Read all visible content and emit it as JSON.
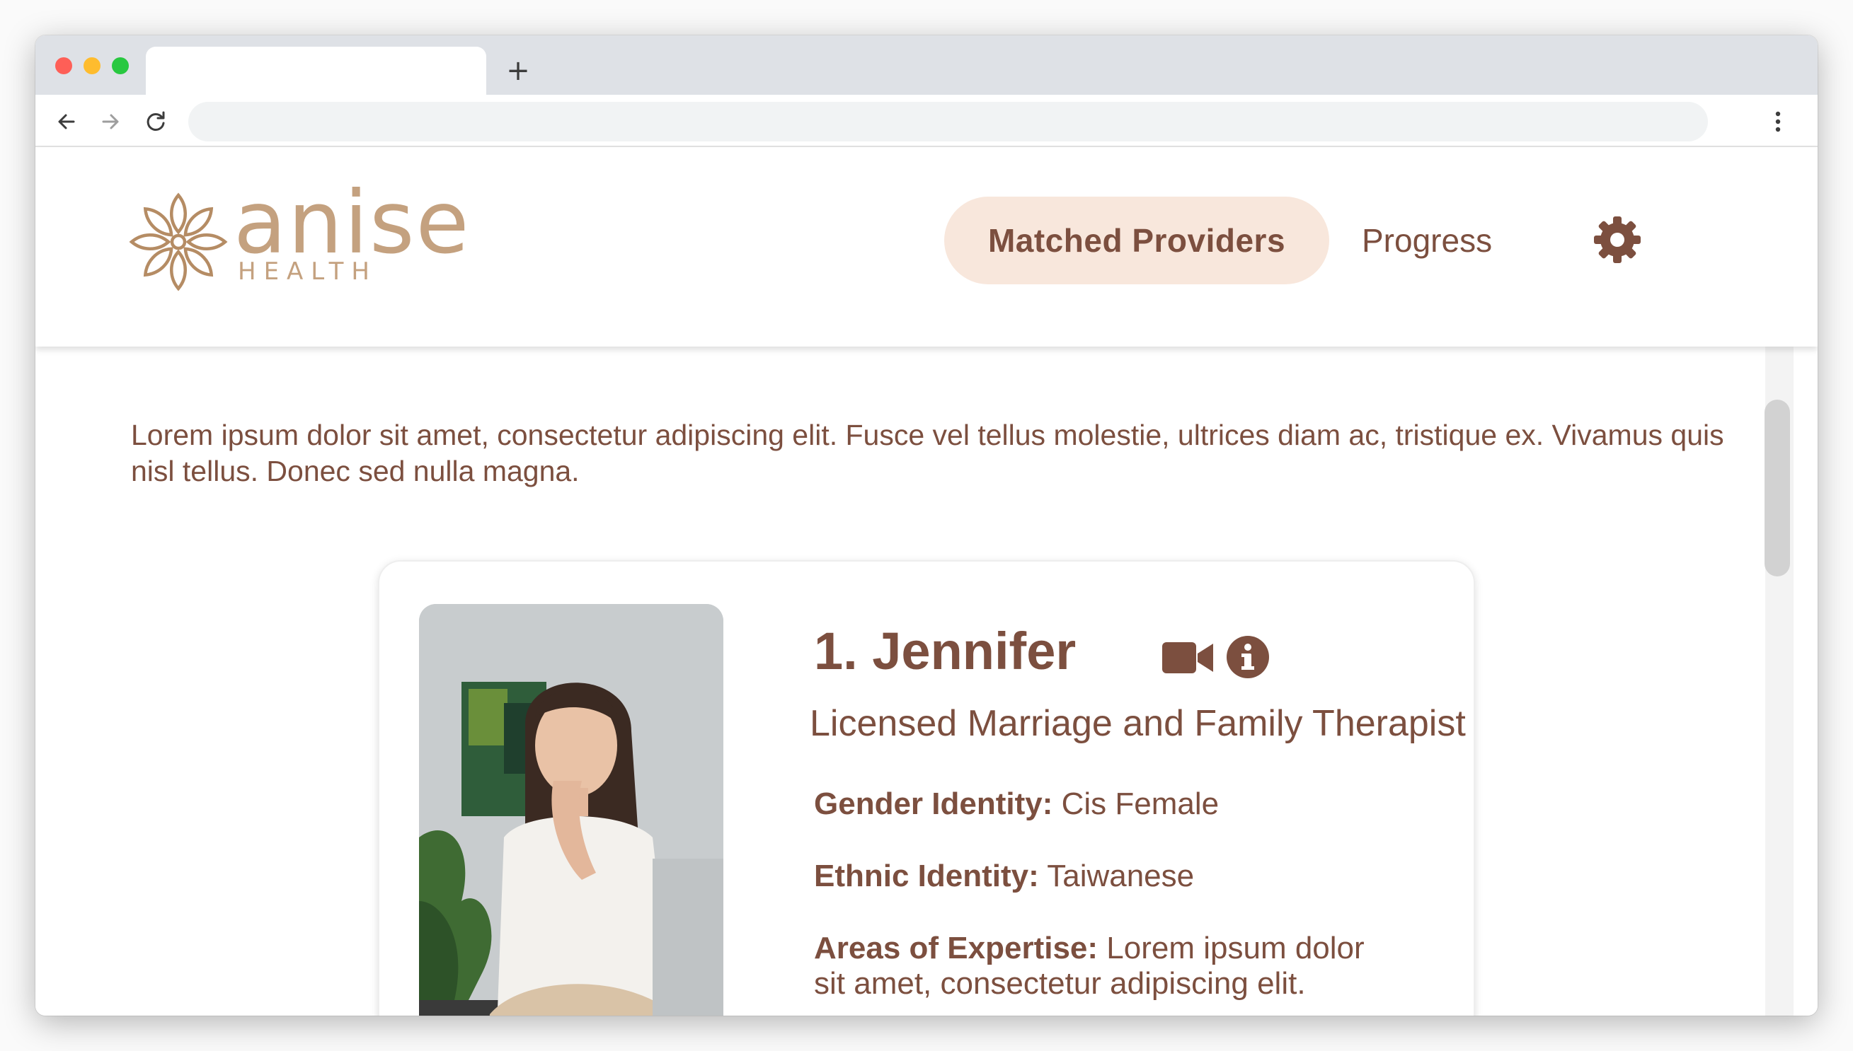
{
  "browser": {
    "new_tab_label": "+",
    "url": ""
  },
  "brand": {
    "name": "anise",
    "subtitle": "HEALTH",
    "color": "#c4a17f"
  },
  "nav": {
    "active_label": "Matched Providers",
    "progress_label": "Progress",
    "settings_icon": "gear-icon",
    "accent_bg": "#f8e7dc",
    "text_color": "#7c4f3f"
  },
  "intro": {
    "text": "Lorem ipsum dolor sit amet, consectetur adipiscing elit. Fusce vel tellus molestie, ultrices diam ac, tristique ex. Vivamus quis nisl tellus. Donec sed nulla magna."
  },
  "provider": {
    "name": "1. Jennifer",
    "title": "Licensed Marriage and Family Therapist",
    "icons": [
      "video-camera-icon",
      "info-icon"
    ],
    "fields": [
      {
        "label": "Gender Identity:",
        "value": "Cis Female"
      },
      {
        "label": "Ethnic Identity:",
        "value": "Taiwanese"
      },
      {
        "label": "Areas of Expertise:",
        "value": "Lorem ipsum dolor sit amet, consectetur adipiscing elit."
      }
    ]
  }
}
